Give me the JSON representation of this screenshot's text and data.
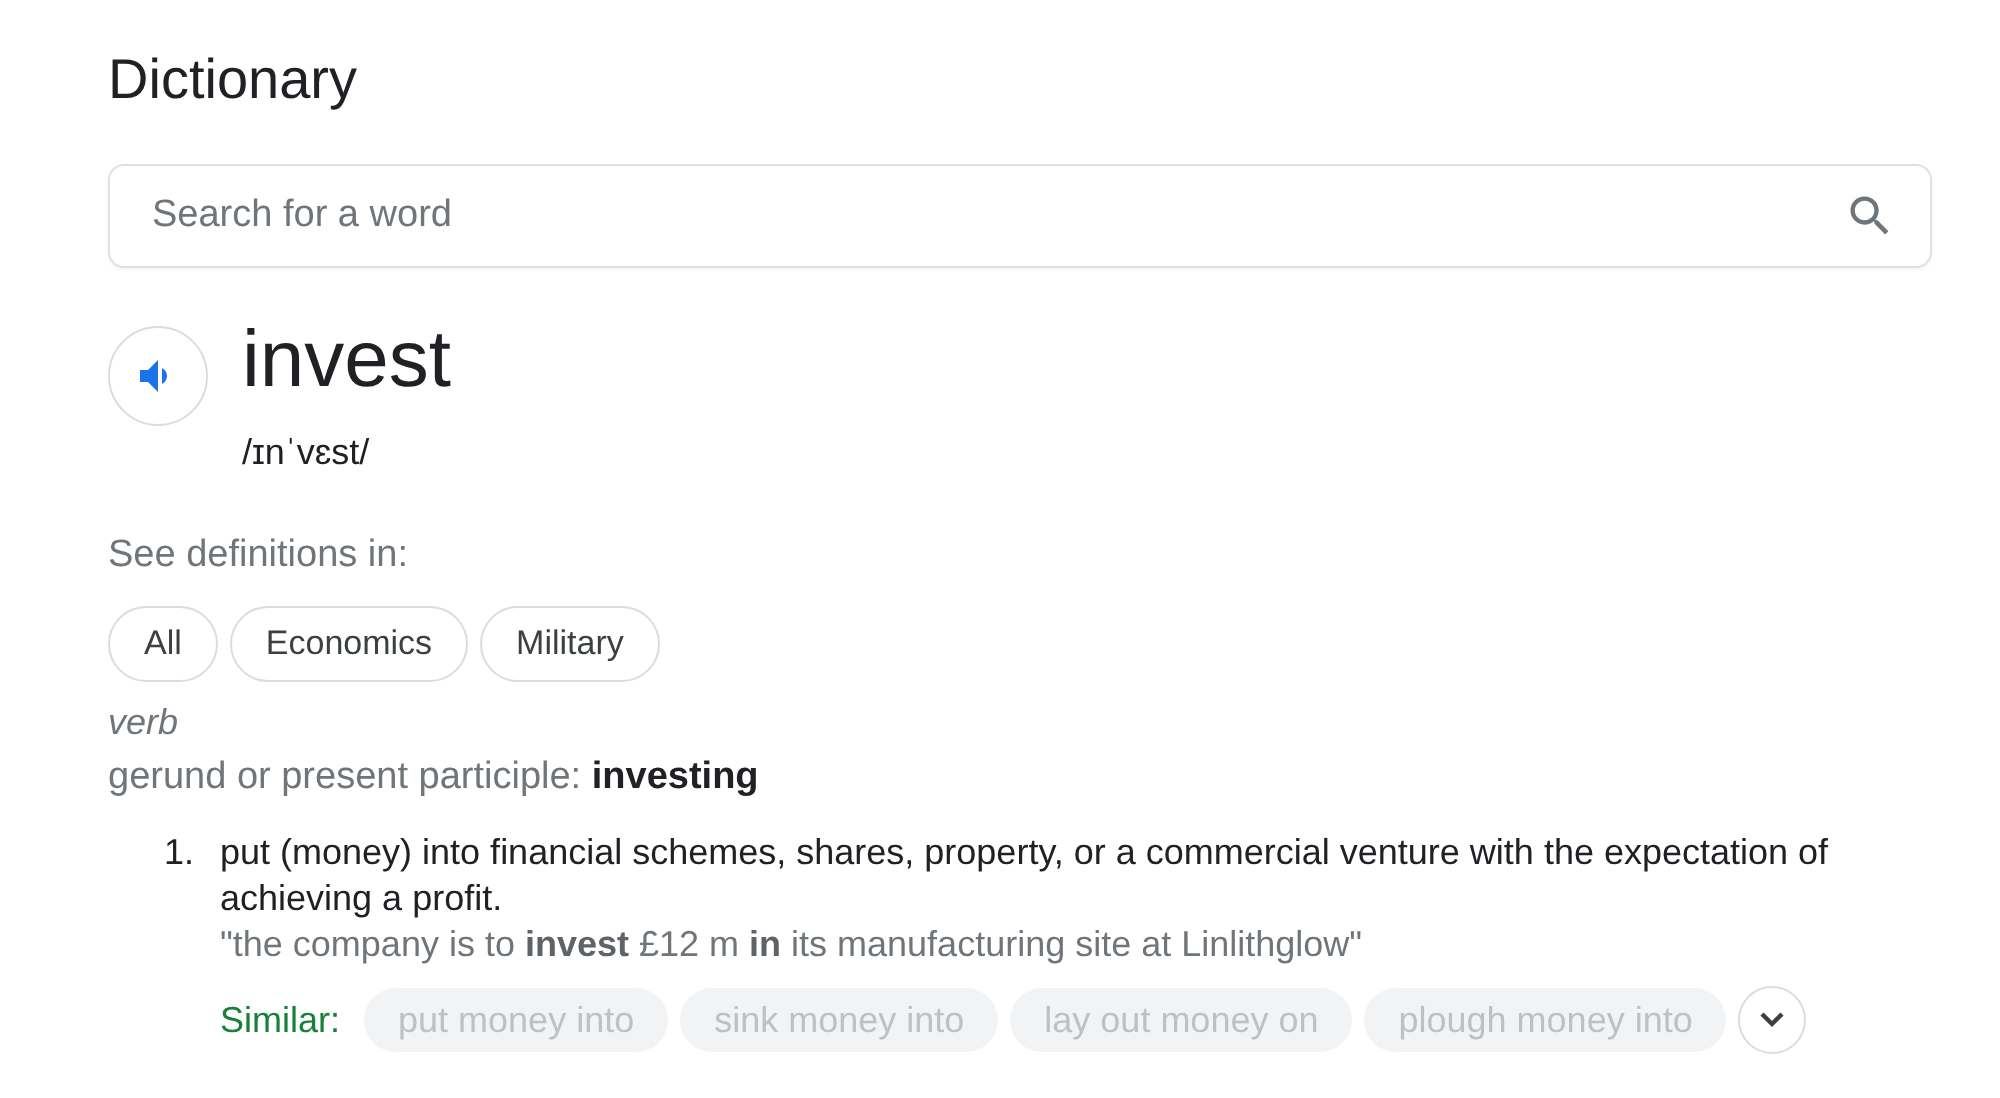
{
  "title": "Dictionary",
  "search": {
    "placeholder": "Search for a word"
  },
  "entry": {
    "word": "invest",
    "phonetic": "/ɪnˈvɛst/"
  },
  "see_definitions": {
    "label": "See definitions in:",
    "chips": [
      "All",
      "Economics",
      "Military"
    ]
  },
  "part_of_speech": "verb",
  "inflection": "gerund or present participle: **investing**",
  "definitions": [
    {
      "number": "1.",
      "text": "put (money) into financial schemes, shares, property, or a commercial venture with the expectation of achieving a profit.",
      "example": "\"the company is to **invest** £12 m **in** its manufacturing site at Linlithglow\"",
      "similar_label": "Similar:",
      "similar": [
        "put money into",
        "sink money into",
        "lay out money on",
        "plough money into"
      ]
    }
  ]
}
